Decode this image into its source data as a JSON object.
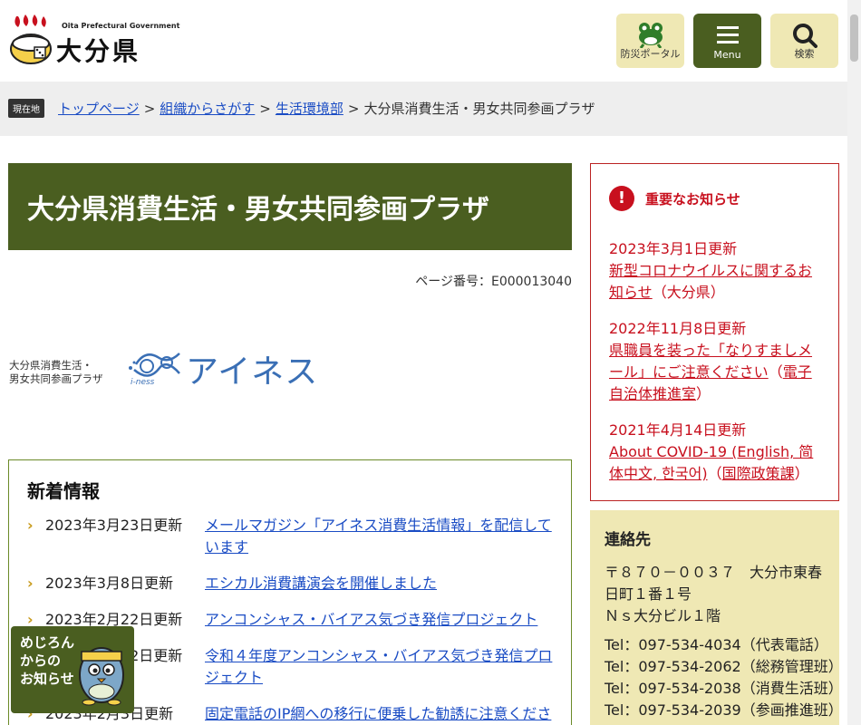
{
  "header": {
    "logo_en": "Oita Prefectural Government",
    "logo_ja": "大分県",
    "disaster_label": "防災ポータル",
    "menu_label": "Menu",
    "search_label": "検索"
  },
  "breadcrumb": {
    "badge": "現在地",
    "items": [
      "トップページ",
      "組織からさがす",
      "生活環境部"
    ],
    "separator": ">",
    "current": "大分県消費生活・男女共同参画プラザ"
  },
  "page": {
    "title": "大分県消費生活・男女共同参画プラザ",
    "page_number": "ページ番号：E000013040"
  },
  "iness": {
    "line1": "大分県消費生活・",
    "line2": "男女共同参画プラザ",
    "mark_text": "i-ness",
    "name": "アイネス"
  },
  "news": {
    "title": "新着情報",
    "items": [
      {
        "date": "2023年3月23日更新",
        "text": "メールマガジン「アイネス消費生活情報」を配信しています"
      },
      {
        "date": "2023年3月8日更新",
        "text": "エシカル消費講演会を開催しました"
      },
      {
        "date": "2023年2月22日更新",
        "text": "アンコンシャス・バイアス気づき発信プロジェクト"
      },
      {
        "date": "2023年2月22日更新",
        "text": "令和４年度アンコンシャス・バイアス気づき発信プロジェクト"
      },
      {
        "date": "2023年2月3日更新",
        "text": "固定電話のIP網への移行に便乗した勧誘に注意ください"
      }
    ]
  },
  "notices": {
    "title": "重要なお知らせ",
    "items": [
      {
        "date": "2023年3月1日更新",
        "link": "新型コロナウイルスに関するお知らせ",
        "dept": "大分県",
        "dept_link": false
      },
      {
        "date": "2022年11月8日更新",
        "link": "県職員を装った「なりすましメール」にご注意ください",
        "dept": "電子自治体推進室",
        "dept_link": true
      },
      {
        "date": "2021年4月14日更新",
        "link": "About COVID-19 (English, 简体中文, 한국어)",
        "dept": "国際政策課",
        "dept_link": true
      }
    ]
  },
  "contact": {
    "title": "連絡先",
    "address_line1": "〒８７０－００３７　大分市東春日町１番１号",
    "address_line2": "Ｎｓ大分ビル１階",
    "tels": [
      "Tel：097-534-4034（代表電話）",
      "Tel：097-534-2062（総務管理班）",
      "Tel：097-534-2038（消費生活班）",
      "Tel：097-534-2039（参画推進班）"
    ]
  },
  "mejiron": {
    "line1": "めじろん",
    "line2": "からの",
    "line3": "お知らせ"
  }
}
